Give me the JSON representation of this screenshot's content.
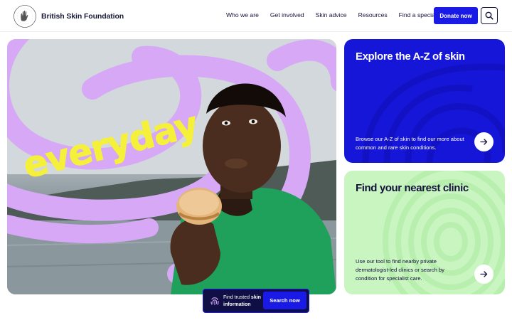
{
  "brand": {
    "name": "British Skin Foundation",
    "logo_icon": "hand-logo-icon"
  },
  "nav": {
    "items": [
      {
        "label": "Who we are"
      },
      {
        "label": "Get involved"
      },
      {
        "label": "Skin advice"
      },
      {
        "label": "Resources"
      },
      {
        "label": "Find a specialist"
      }
    ],
    "donate_label": "Donate now",
    "search_icon": "search-icon"
  },
  "hero": {
    "overlay_word": "everyday",
    "accent_color": "#d6a8f5",
    "word_color": "#f5f03a"
  },
  "cards": {
    "az": {
      "title": "Explore the A-Z of skin",
      "description": "Browse our A-Z of skin to find our more about common and rare skin conditions.",
      "background": "#1616d8"
    },
    "clinic": {
      "title": "Find your nearest clinic",
      "description": "Use our tool to find nearby private dermatologist-led clinics or search by condition for specialist care.",
      "background": "#c9f5c0"
    }
  },
  "search_bar": {
    "text_prefix": "Find trusted ",
    "text_bold": "skin",
    "text_line2": "information",
    "button_label": "Search now",
    "icon": "fingerprint-icon"
  }
}
